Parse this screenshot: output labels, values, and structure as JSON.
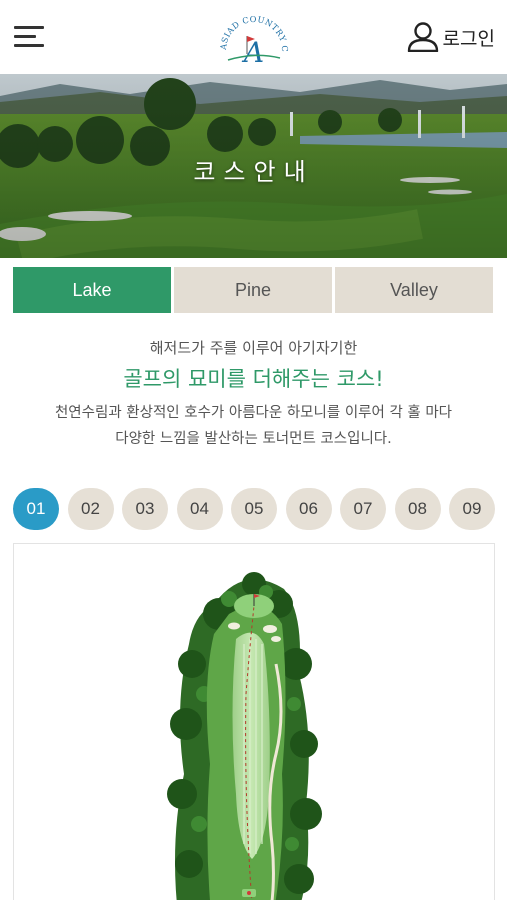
{
  "header": {
    "menu_icon": "hamburger-menu-icon",
    "logo_text": "ASIAD COUNTRY CLUB",
    "logo_letter": "A",
    "login_icon": "user-icon",
    "login_label": "로그인"
  },
  "hero": {
    "title": "코스안내"
  },
  "tabs": [
    {
      "label": "Lake",
      "active": true
    },
    {
      "label": "Pine",
      "active": false
    },
    {
      "label": "Valley",
      "active": false
    }
  ],
  "intro": {
    "subtitle": "해저드가 주를 이루어 아기자기한",
    "headline": "골프의 묘미를 더해주는 코스!",
    "description_line1": "천연수림과 환상적인 호수가 아름다운 하모니를 이루어 각 홀 마다",
    "description_line2": "다양한 느낌을 발산하는 토너먼트 코스입니다."
  },
  "holes": [
    {
      "label": "01",
      "active": true
    },
    {
      "label": "02",
      "active": false
    },
    {
      "label": "03",
      "active": false
    },
    {
      "label": "04",
      "active": false
    },
    {
      "label": "05",
      "active": false
    },
    {
      "label": "06",
      "active": false
    },
    {
      "label": "07",
      "active": false
    },
    {
      "label": "08",
      "active": false
    },
    {
      "label": "09",
      "active": false
    }
  ],
  "colors": {
    "accent_green": "#2f9968",
    "accent_blue": "#2a9bc7",
    "tab_inactive": "#e3ddd3"
  }
}
